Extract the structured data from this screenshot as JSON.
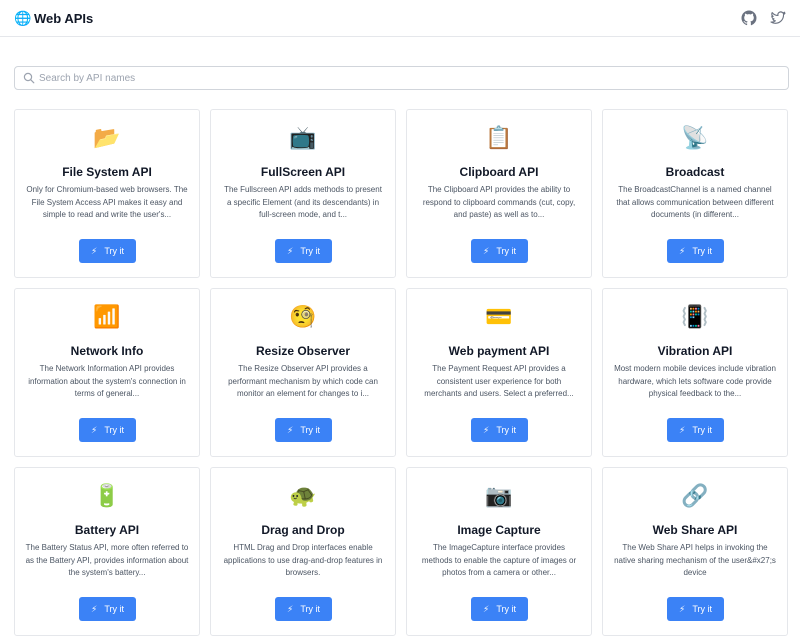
{
  "header": {
    "brand_icon": "🌐",
    "title": "Web APIs",
    "github_icon": "github-icon",
    "twitter_icon": "twitter-icon"
  },
  "search": {
    "placeholder": "Search by API names",
    "value": ""
  },
  "try_label": "Try it",
  "cards": [
    {
      "icon": "📂",
      "title": "File System API",
      "description": "Only for Chromium-based web browsers. The File System Access API makes it easy and simple to read and write the user's..."
    },
    {
      "icon": "📺",
      "title": "FullScreen API",
      "description": "The Fullscreen API adds methods to present a specific Element (and its descendants) in full-screen mode, and t..."
    },
    {
      "icon": "📋",
      "title": "Clipboard API",
      "description": "The Clipboard API provides the ability to respond to clipboard commands (cut, copy, and paste) as well as to..."
    },
    {
      "icon": "📡",
      "title": "Broadcast",
      "description": "The BroadcastChannel is a named channel that allows communication between different documents (in different..."
    },
    {
      "icon": "📶",
      "title": "Network Info",
      "description": "The Network Information API provides information about the system's connection in terms of general..."
    },
    {
      "icon": "🧐",
      "title": "Resize Observer",
      "description": "The Resize Observer API provides a performant mechanism by which code can monitor an element for changes to i..."
    },
    {
      "icon": "💳",
      "title": "Web payment API",
      "description": "The Payment Request API provides a consistent user experience for both merchants and users. Select a preferred..."
    },
    {
      "icon": "📳",
      "title": "Vibration API",
      "description": "Most modern mobile devices include vibration hardware, which lets software code provide physical feedback to the..."
    },
    {
      "icon": "🔋",
      "title": "Battery API",
      "description": "The Battery Status API, more often referred to as the Battery API, provides information about the system's battery..."
    },
    {
      "icon": "🐢",
      "title": "Drag and Drop",
      "description": "HTML Drag and Drop interfaces enable applications to use drag-and-drop features in browsers."
    },
    {
      "icon": "📷",
      "title": "Image Capture",
      "description": "The ImageCapture interface provides methods to enable the capture of images or photos from a camera or other..."
    },
    {
      "icon": "🔗",
      "title": "Web Share API",
      "description": "The Web Share API helps in invoking the native sharing mechanism of the user&#x27;s device"
    }
  ]
}
